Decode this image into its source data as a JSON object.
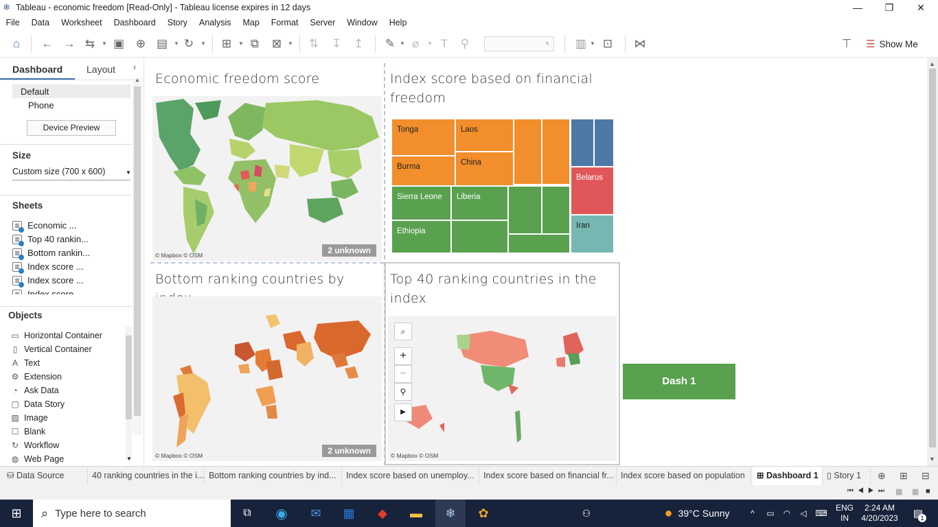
{
  "window": {
    "title": "Tableau - economic freedom [Read-Only] - Tableau license expires in 12 days"
  },
  "menu": [
    "File",
    "Data",
    "Worksheet",
    "Dashboard",
    "Story",
    "Analysis",
    "Map",
    "Format",
    "Server",
    "Window",
    "Help"
  ],
  "toolbar": {
    "show_me": "Show Me"
  },
  "left_pane": {
    "tab_dashboard": "Dashboard",
    "tab_layout": "Layout",
    "device_default": "Default",
    "device_phone": "Phone",
    "device_preview": "Device Preview",
    "size_heading": "Size",
    "size_value": "Custom size (700 x 600)",
    "sheets_heading": "Sheets",
    "sheets": [
      "Economic ...",
      "Top 40 rankin...",
      "Bottom rankin...",
      "Index score ...",
      "Index score ...",
      "Index score ..."
    ],
    "objects_heading": "Objects",
    "objects": [
      {
        "label": "Horizontal Container",
        "icon": "horizontal-container-icon"
      },
      {
        "label": "Vertical Container",
        "icon": "vertical-container-icon"
      },
      {
        "label": "Text",
        "icon": "text-icon"
      },
      {
        "label": "Extension",
        "icon": "extension-icon"
      },
      {
        "label": "Ask Data",
        "icon": "ask-data-icon"
      },
      {
        "label": "Data Story",
        "icon": "data-story-icon"
      },
      {
        "label": "Image",
        "icon": "image-icon"
      },
      {
        "label": "Blank",
        "icon": "blank-icon"
      },
      {
        "label": "Workflow",
        "icon": "workflow-icon"
      },
      {
        "label": "Web Page",
        "icon": "web-page-icon"
      }
    ]
  },
  "dashboard": {
    "panel1_title": "Economic freedom score",
    "panel2_title": "Index score based on financial freedom",
    "panel3_title": "Bottom ranking countries by index",
    "panel4_title": "Top 40 ranking countries in the index",
    "map_attribution": "© Mapbox © OSM",
    "unknown_badge": "2 unknown",
    "dash_button": "Dash 1",
    "treemap": [
      "Tonga",
      "Laos",
      "Burma",
      "China",
      "Sierra Leone",
      "Liberia",
      "Ethiopia",
      "Belarus",
      "Iran"
    ],
    "colors": {
      "orange": "#f28e2b",
      "green": "#59a14f",
      "blue": "#4e79a7",
      "red": "#e15759",
      "teal": "#76b7b2"
    }
  },
  "bottom_tabs": [
    "Data Source",
    "40 ranking countries in the i...",
    "Bottom ranking countries by ind...",
    "Index score based on unemploy...",
    "Index score based on financial fr...",
    "Index score based on population",
    "Dashboard 1",
    "Story 1"
  ],
  "taskbar": {
    "search_placeholder": "Type here to search",
    "weather": "39°C  Sunny",
    "lang1": "ENG",
    "lang2": "IN",
    "time": "2:24 AM",
    "date": "4/20/2023",
    "notif_count": "1"
  }
}
